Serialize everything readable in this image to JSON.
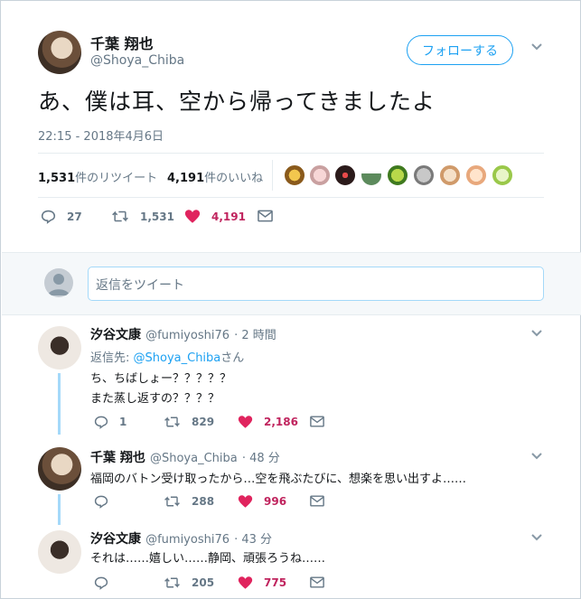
{
  "main_tweet": {
    "display_name": "千葉 翔也",
    "handle": "@Shoya_Chiba",
    "follow_label": "フォローする",
    "text": "あ、僕は耳、空から帰ってきましたよ",
    "timestamp": "22:15 - 2018年4月6日",
    "retweets_count": "1,531",
    "retweets_label": "件のリツイート",
    "likes_count": "4,191",
    "likes_label": "件のいいね",
    "reply_count": "27",
    "retweet_count": "1,531",
    "like_count": "4,191"
  },
  "reply_box": {
    "placeholder": "返信をツイート"
  },
  "replies": [
    {
      "display_name": "汐谷文康",
      "handle": "@fumiyoshi76",
      "time": "· 2 時間",
      "reply_to_prefix": "返信先: ",
      "reply_to_handle": "@Shoya_Chiba",
      "reply_to_suffix": "さん",
      "line1": "ち、ちばしょー？？？？？",
      "line2": "また蒸し返すの？？？？",
      "reply_count": "1",
      "retweet_count": "829",
      "like_count": "2,186"
    },
    {
      "display_name": "千葉 翔也",
      "handle": "@Shoya_Chiba",
      "time": "· 48 分",
      "line1": "福岡のバトン受け取ったから…空を飛ぶたびに、想楽を思い出すよ……",
      "reply_count": "",
      "retweet_count": "288",
      "like_count": "996"
    },
    {
      "display_name": "汐谷文康",
      "handle": "@fumiyoshi76",
      "time": "· 43 分",
      "line1": "それは……嬉しい……静岡、頑張ろうね……",
      "reply_count": "",
      "retweet_count": "205",
      "like_count": "775"
    }
  ],
  "colors": {
    "accent": "#1da1f2",
    "like": "#e0245e",
    "muted": "#657786"
  },
  "icons": [
    "chevron-down-icon",
    "reply-icon",
    "retweet-icon",
    "heart-icon",
    "mail-icon"
  ]
}
